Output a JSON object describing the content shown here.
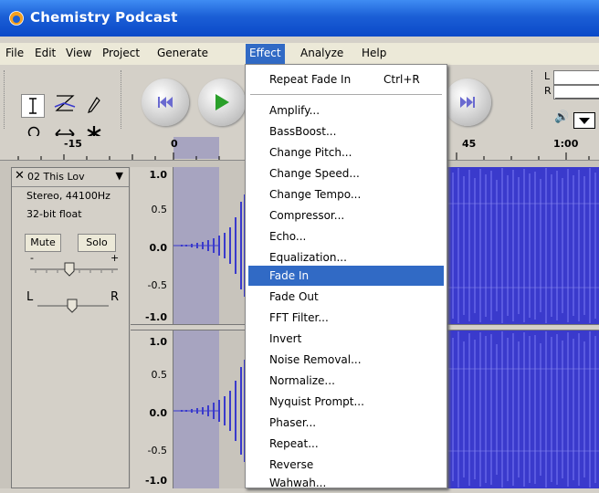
{
  "window": {
    "title": "Chemistry Podcast"
  },
  "menubar": {
    "items": [
      "File",
      "Edit",
      "View",
      "Project",
      "Generate",
      "Effect",
      "Analyze",
      "Help"
    ],
    "active": "Effect"
  },
  "ruler": {
    "ticks": [
      "-15",
      "0",
      "45",
      "1:00"
    ]
  },
  "meter": {
    "left_label": "L",
    "right_label": "R"
  },
  "track": {
    "name": "02 This Lov",
    "format": "Stereo, 44100Hz",
    "bit_depth": "32-bit float",
    "mute_label": "Mute",
    "solo_label": "Solo",
    "gain_minus": "-",
    "gain_plus": "+",
    "pan_left": "L",
    "pan_right": "R"
  },
  "scale": {
    "top": [
      "1.0",
      "0.5",
      "0.0",
      "-0.5",
      "-1.0"
    ],
    "bottom": [
      "1.0",
      "0.5",
      "0.0",
      "-0.5",
      "-1.0"
    ]
  },
  "effect_menu": {
    "repeat": {
      "label": "Repeat Fade In",
      "shortcut": "Ctrl+R"
    },
    "items": [
      "Amplify...",
      "BassBoost...",
      "Change Pitch...",
      "Change Speed...",
      "Change Tempo...",
      "Compressor...",
      "Echo...",
      "Equalization...",
      "Fade In",
      "Fade Out",
      "FFT Filter...",
      "Invert",
      "Noise Removal...",
      "Normalize...",
      "Nyquist Prompt...",
      "Phaser...",
      "Repeat...",
      "Reverse",
      "Wahwah..."
    ],
    "highlighted": "Fade In"
  },
  "colors": {
    "titlebar": "#0a49c8",
    "highlight": "#316ac5",
    "waveform": "#3a3acc",
    "selection": "#a7a4c0"
  }
}
